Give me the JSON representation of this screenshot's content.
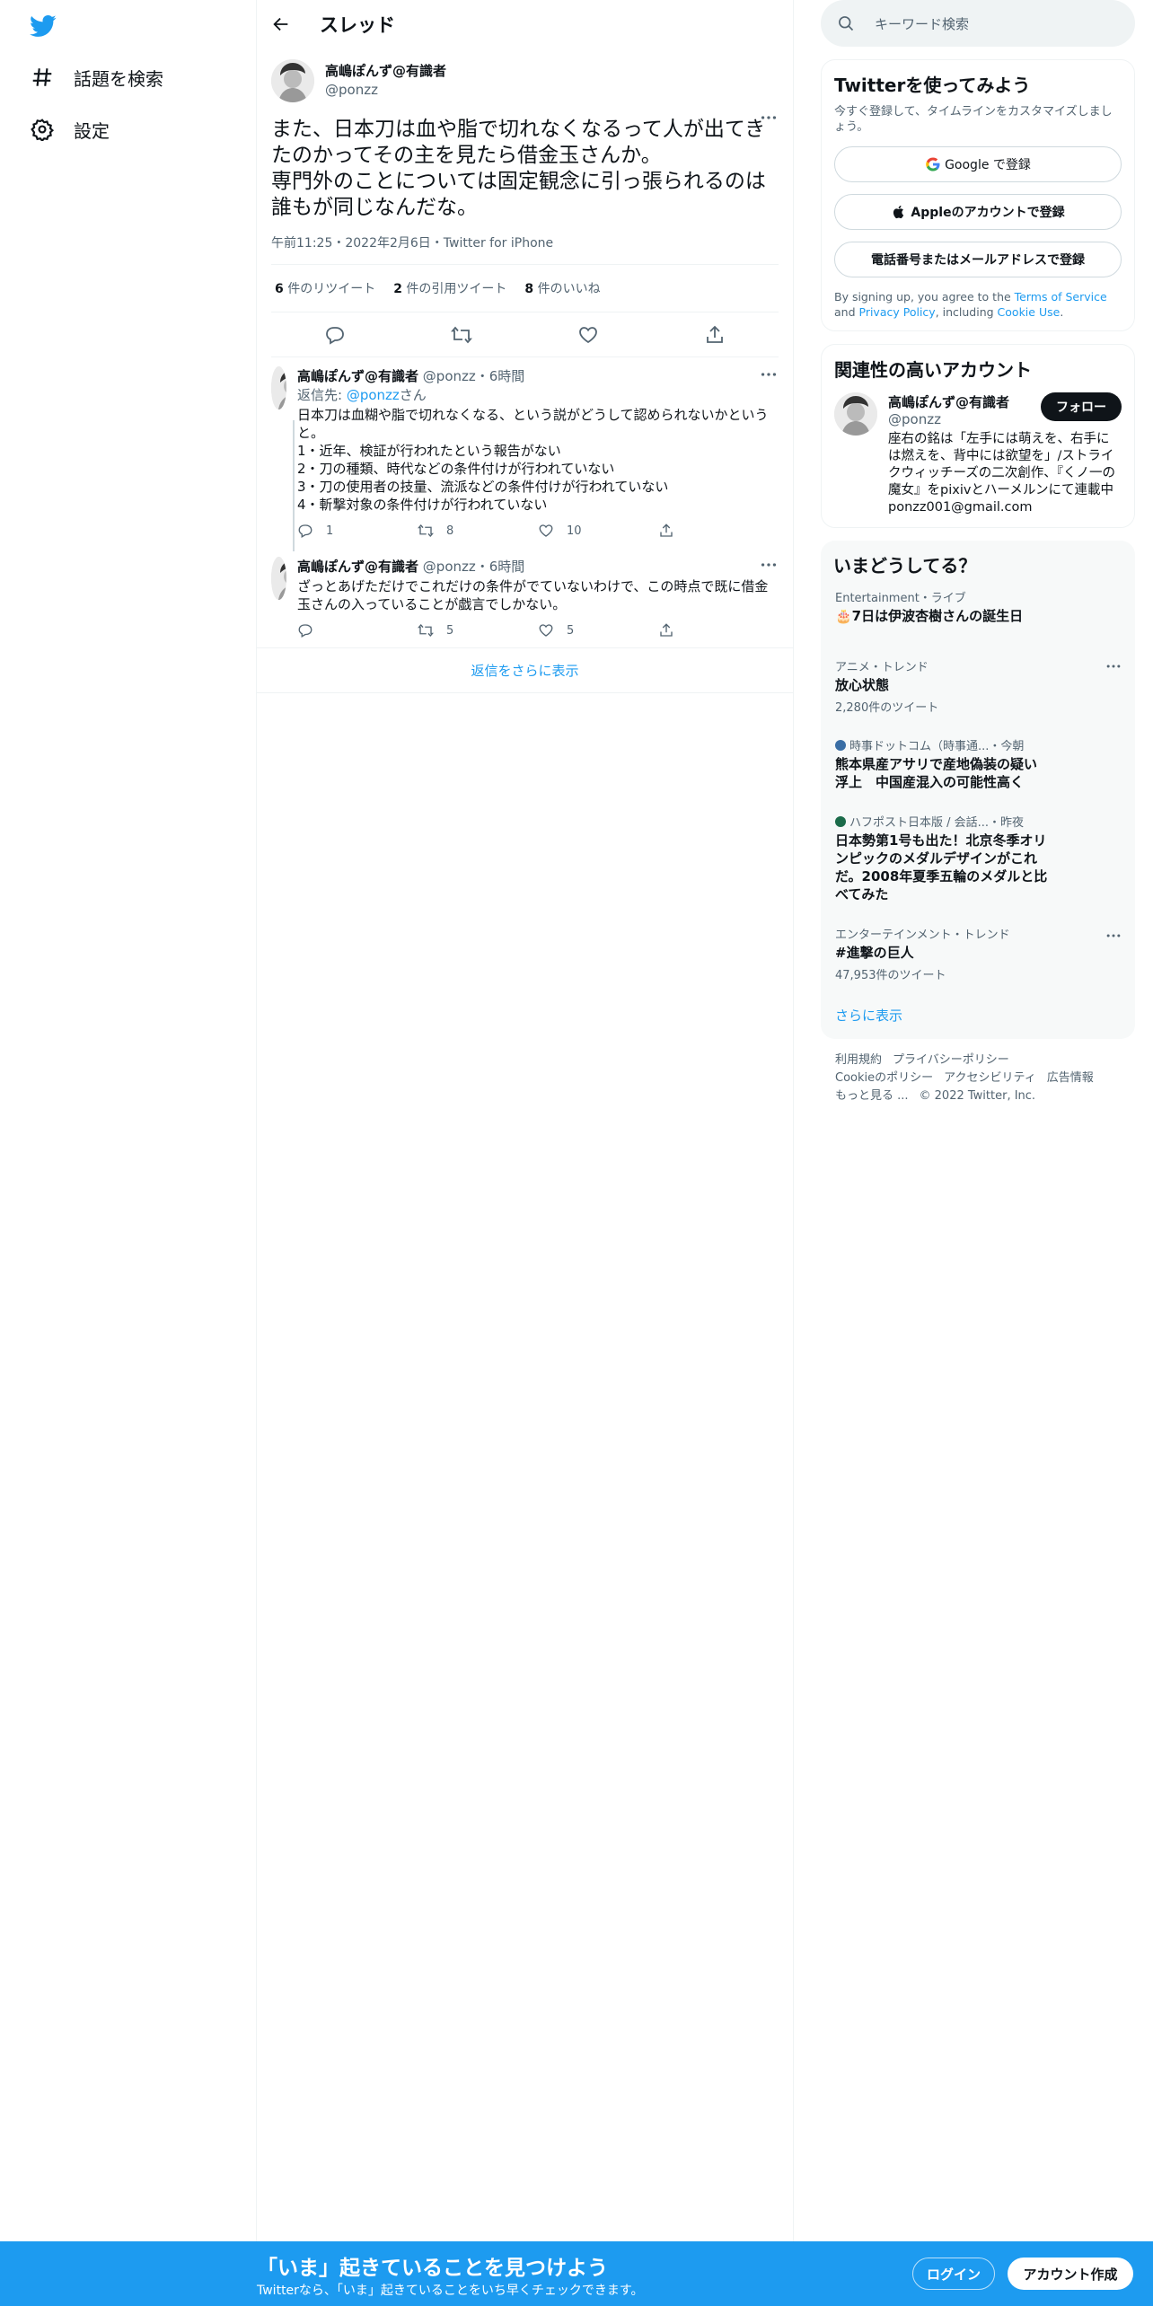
{
  "nav": {
    "explore_label": "話題を検索",
    "settings_label": "設定"
  },
  "header": {
    "title": "スレッド"
  },
  "focus_tweet": {
    "author_name": "高嶋ぽんず@有識者",
    "author_handle": "@ponzz",
    "text": "また、日本刀は血や脂で切れなくなるって人が出てきたのかってその主を見たら借金玉さんか。\n専門外のことについては固定観念に引っ張られるのは誰もが同じなんだな。",
    "meta": "午前11:25・2022年2月6日・Twitter for iPhone",
    "retweets_num": "6",
    "retweets_label": "件のリツイート",
    "quotes_num": "2",
    "quotes_label": "件の引用ツイート",
    "likes_num": "8",
    "likes_label": "件のいいね"
  },
  "replies": [
    {
      "author_name": "高嶋ぽんず@有識者",
      "author_handle": "@ponzz",
      "time": "・6時間",
      "reply_to_prefix": "返信先: ",
      "reply_to_handle": "@ponzz",
      "reply_to_suffix": "さん",
      "text": "日本刀は血糊や脂で切れなくなる、という説がどうして認められないかというと。\n1・近年、検証が行われたという報告がない\n2・刀の種類、時代などの条件付けが行われていない\n3・刀の使用者の技量、流派などの条件付けが行われていない\n4・斬撃対象の条件付けが行われていない",
      "reply_count": "1",
      "retweet_count": "8",
      "like_count": "10"
    },
    {
      "author_name": "高嶋ぽんず@有識者",
      "author_handle": "@ponzz",
      "time": "・6時間",
      "text": "ざっとあげただけでこれだけの条件がでていないわけで、この時点で既に借金玉さんの入っていることが戯言でしかない。",
      "reply_count": "",
      "retweet_count": "5",
      "like_count": "5"
    }
  ],
  "more_replies_label": "返信をさらに表示",
  "search": {
    "placeholder": "キーワード検索"
  },
  "signup_card": {
    "title": "Twitterを使ってみよう",
    "subtitle": "今すぐ登録して、タイムラインをカスタマイズしましょう。",
    "google_label": "Google で登録",
    "apple_label": "Appleのアカウントで登録",
    "phone_label": "電話番号またはメールアドレスで登録",
    "legal_prefix": "By signing up, you agree to the ",
    "terms": "Terms of Service",
    "and": " and ",
    "privacy": "Privacy Policy",
    "including": ", including ",
    "cookie": "Cookie Use",
    "period": "."
  },
  "related": {
    "title": "関連性の高いアカウント",
    "name": "高嶋ぽんず@有識者",
    "handle": "@ponzz",
    "follow_label": "フォロー",
    "bio": "座右の銘は「左手には萌えを、右手には燃えを、背中には欲望を」/ストライクウィッチーズの二次創作、『くノ一の魔女』をpixivとハーメルンにて連載中 ponzz001@gmail.com"
  },
  "trends": {
    "title": "いまどうしてる？",
    "items": [
      {
        "context": "Entertainment・ライブ",
        "title": "🎂7日は伊波杏樹さんの誕生日",
        "count": ""
      },
      {
        "context": "アニメ・トレンド",
        "title": "放心状態",
        "count": "2,280件のツイート"
      },
      {
        "context": "時事ドットコム（時事通...・今朝",
        "title": "熊本県産アサリで産地偽装の疑い浮上　中国産混入の可能性高く",
        "count": ""
      },
      {
        "context": "ハフポスト日本版 / 会話...・昨夜",
        "title": "日本勢第1号も出た！北京冬季オリンピックのメダルデザインがこれだ。2008年夏季五輪のメダルと比べてみた",
        "count": ""
      },
      {
        "context": "エンターテインメント・トレンド",
        "title": "#進撃の巨人",
        "count": "47,953件のツイート"
      }
    ],
    "show_more": "さらに表示"
  },
  "footer": {
    "terms": "利用規約",
    "privacy": "プライバシーポリシー",
    "cookie": "Cookieのポリシー",
    "accessibility": "アクセシビリティ",
    "ads": "広告情報",
    "more": "もっと見る ...",
    "copyright": "© 2022 Twitter, Inc."
  },
  "bottom_bar": {
    "headline": "「いま」起きていることを見つけよう",
    "sub": "Twitterなら、「いま」起きていることをいち早くチェックできます。",
    "login_label": "ログイン",
    "signup_label": "アカウント作成"
  },
  "colors": {
    "accent": "#1d9bf0",
    "text": "#0f1419",
    "muted": "#536471"
  }
}
